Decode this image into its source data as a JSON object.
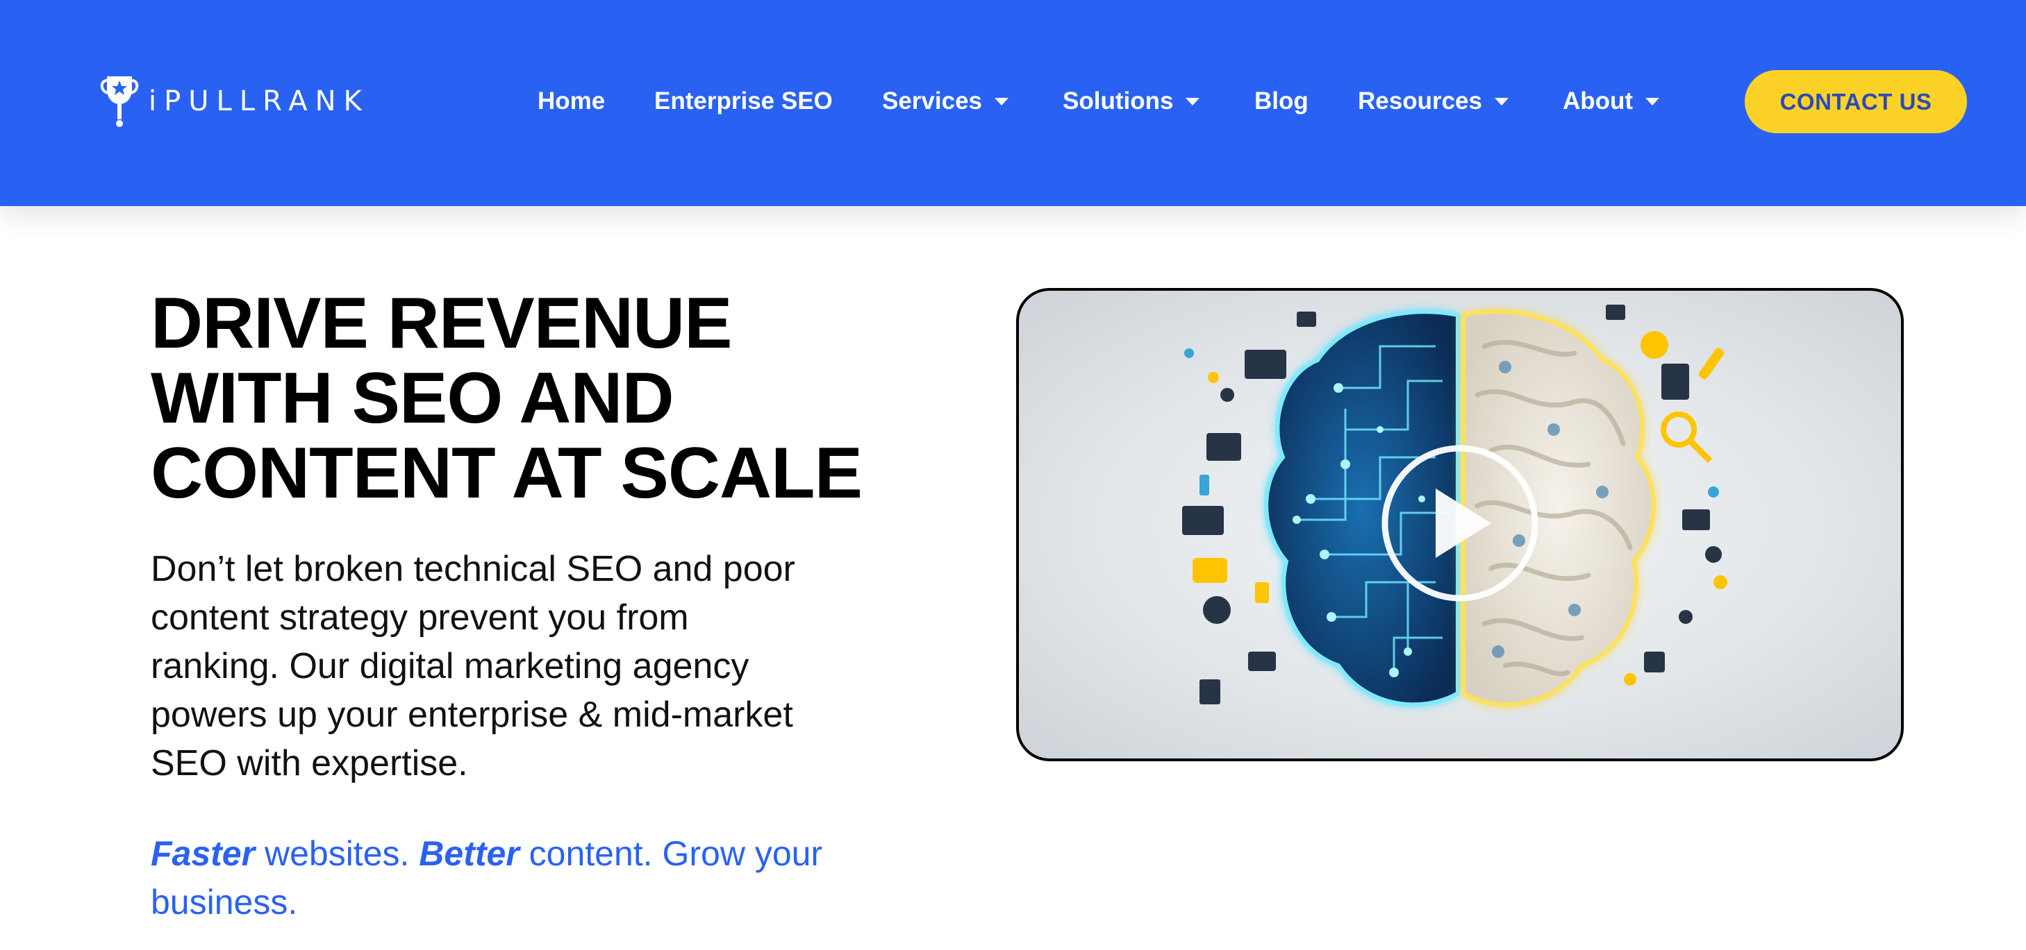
{
  "header": {
    "logo_text": "iPULLRANK",
    "nav": [
      {
        "label": "Home",
        "dropdown": false
      },
      {
        "label": "Enterprise SEO",
        "dropdown": false
      },
      {
        "label": "Services",
        "dropdown": true
      },
      {
        "label": "Solutions",
        "dropdown": true
      },
      {
        "label": "Blog",
        "dropdown": false
      },
      {
        "label": "Resources",
        "dropdown": true
      },
      {
        "label": "About",
        "dropdown": true
      }
    ],
    "contact_label": "CONTACT US"
  },
  "hero": {
    "title_lines": [
      "DRIVE REVENUE",
      "WITH SEO AND",
      "CONTENT AT SCALE"
    ],
    "description_lines": [
      "Don’t let broken technical SEO and poor",
      "content strategy prevent you from",
      "ranking. Our digital marketing agency",
      "powers up your enterprise & mid-market",
      "SEO with expertise."
    ],
    "tagline": {
      "bold1": "Faster",
      "text1": " websites. ",
      "bold2": "Better",
      "text2": " content. Grow your business."
    }
  },
  "video": {
    "play_icon": "play-icon",
    "image": "brain-circuit-illustration"
  },
  "colors": {
    "header_bg": "#2962f2",
    "cta_bg": "#fcd226",
    "cta_text": "#2b4ab8",
    "tagline": "#2962f2",
    "circuit_cyan": "#2fd2f5",
    "brain_gold": "#ffd21a"
  }
}
